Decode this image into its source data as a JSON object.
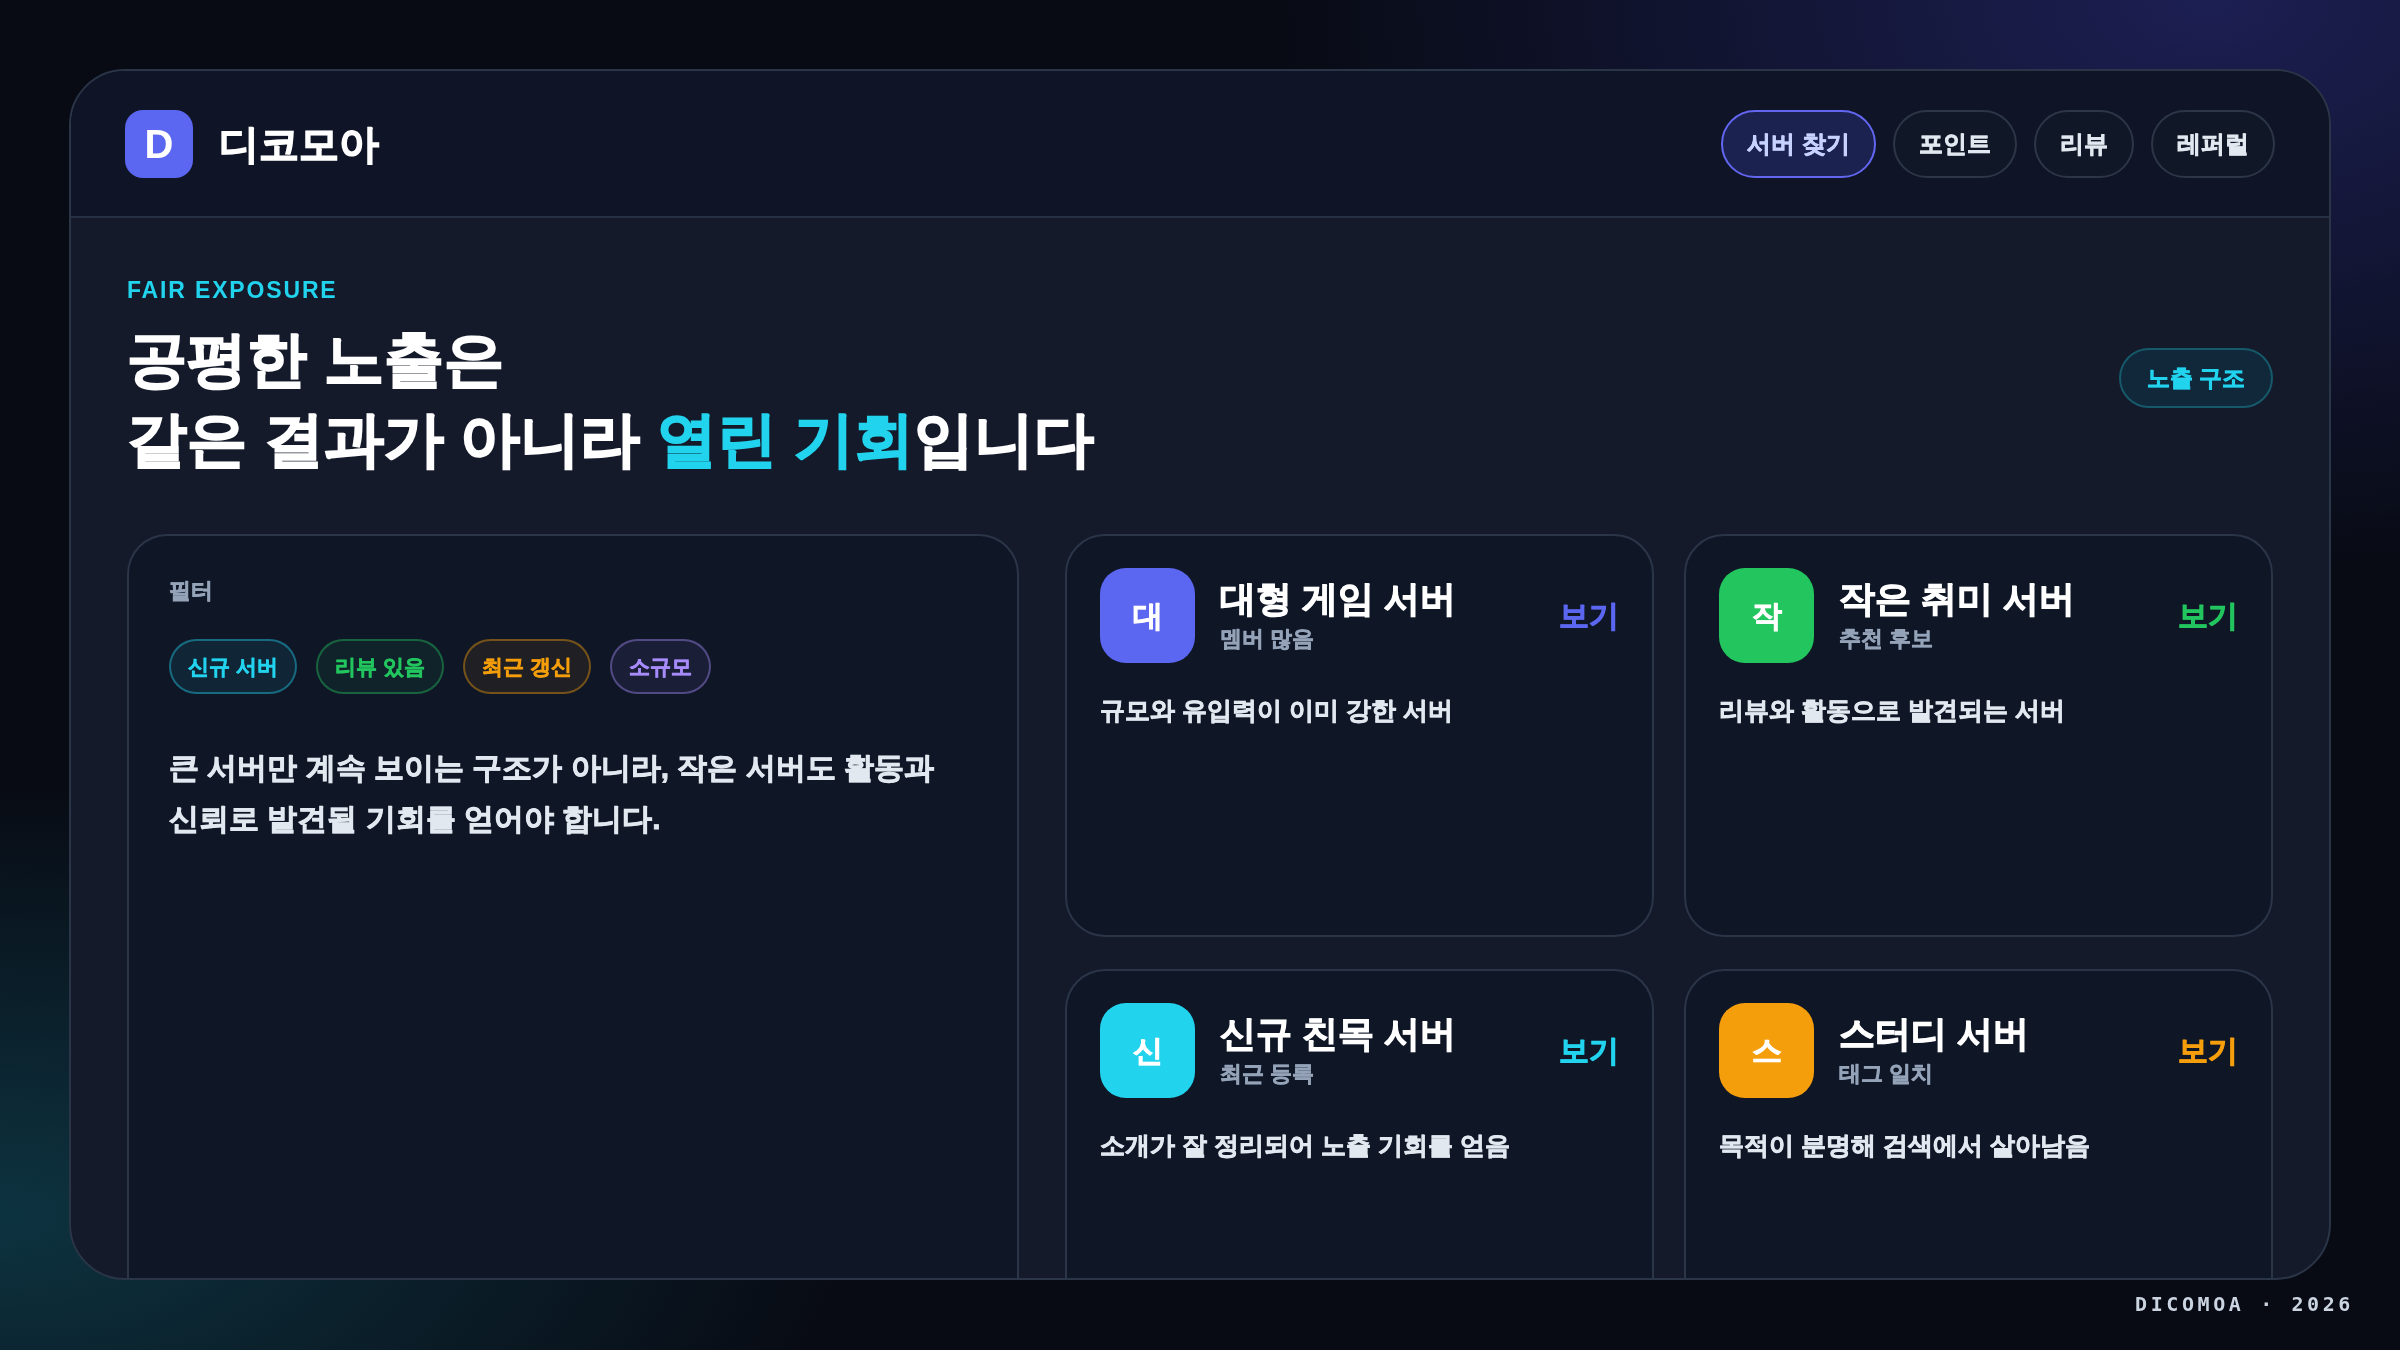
{
  "brand": {
    "logo_letter": "D",
    "name": "디코모아"
  },
  "nav": [
    {
      "label": "서버 찾기",
      "selected": true
    },
    {
      "label": "포인트",
      "selected": false
    },
    {
      "label": "리뷰",
      "selected": false
    },
    {
      "label": "레퍼럴",
      "selected": false
    }
  ],
  "hero": {
    "eyebrow": "FAIR EXPOSURE",
    "title_lines": [
      [
        {
          "text": "공평한 노출은",
          "highlight": false
        }
      ],
      [
        {
          "text": "같은 결과가 아니라 ",
          "highlight": false
        },
        {
          "text": "열린 기회",
          "highlight": true
        },
        {
          "text": "입니다",
          "highlight": false
        }
      ]
    ],
    "badge": "노출 구조"
  },
  "filter_panel": {
    "label": "필터",
    "chips": [
      {
        "label": "신규 서버",
        "color": "#22d3ee"
      },
      {
        "label": "리뷰 있음",
        "color": "#22c55e"
      },
      {
        "label": "최근 갱신",
        "color": "#f59e0b"
      },
      {
        "label": "소규모",
        "color": "#a78bfa"
      }
    ],
    "description": "큰 서버만 계속 보이는 구조가 아니라, 작은 서버도 활동과 신뢰로 발견될 기회를 얻어야 합니다."
  },
  "servers": [
    {
      "initial": "대",
      "name": "대형 게임 서버",
      "subtitle": "멤버 많음",
      "action": "보기",
      "description": "규모와 유입력이 이미 강한 서버",
      "color": "#5b67f1"
    },
    {
      "initial": "작",
      "name": "작은 취미 서버",
      "subtitle": "추천 후보",
      "action": "보기",
      "description": "리뷰와 활동으로 발견되는 서버",
      "color": "#22c55e"
    },
    {
      "initial": "신",
      "name": "신규 친목 서버",
      "subtitle": "최근 등록",
      "action": "보기",
      "description": "소개가 잘 정리되어 노출 기회를 얻음",
      "color": "#22d3ee"
    },
    {
      "initial": "스",
      "name": "스터디 서버",
      "subtitle": "태그 일치",
      "action": "보기",
      "description": "목적이 분명해 검색에서 살아남음",
      "color": "#f59e0b"
    }
  ],
  "footer": "DICOMOA · 2026"
}
